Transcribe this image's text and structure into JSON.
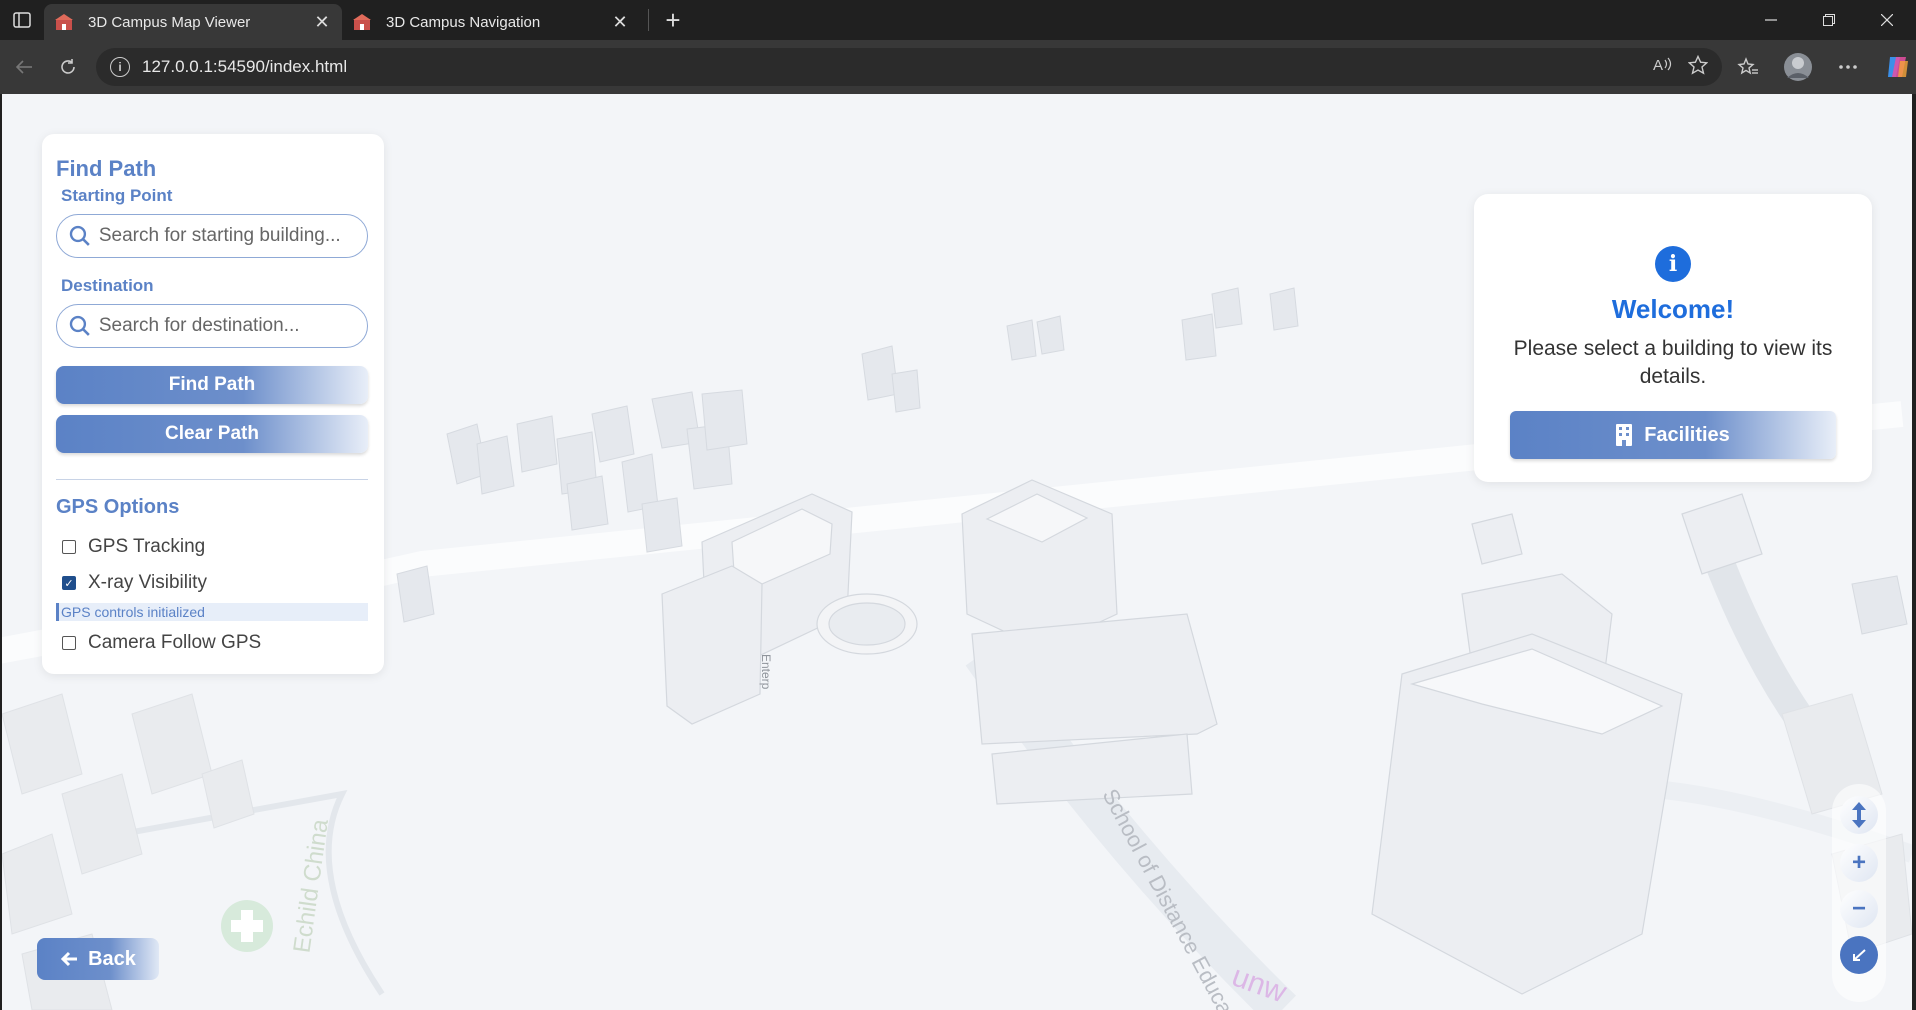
{
  "browser": {
    "tabs": [
      {
        "title": "3D Campus Map Viewer",
        "active": true
      },
      {
        "title": "3D Campus Navigation",
        "active": false
      }
    ],
    "url": "127.0.0.1:54590/index.html"
  },
  "find_path": {
    "title": "Find Path",
    "start_label": "Starting Point",
    "start_placeholder": "Search for starting building...",
    "dest_label": "Destination",
    "dest_placeholder": "Search for destination...",
    "find_button": "Find Path",
    "clear_button": "Clear Path"
  },
  "gps": {
    "title": "GPS Options",
    "tracking_label": "GPS Tracking",
    "tracking_checked": false,
    "xray_label": "X-ray Visibility",
    "xray_checked": true,
    "status": "GPS controls initialized",
    "follow_label": "Camera Follow GPS",
    "follow_checked": false
  },
  "welcome": {
    "title": "Welcome!",
    "message": "Please select a building to view its details.",
    "facilities_button": "Facilities"
  },
  "back_button": "Back",
  "map_labels": {
    "school": "School of Distance Education",
    "road": "Echild China",
    "label_vertical": "Enterp"
  },
  "colors": {
    "accent": "#5b82c6",
    "info_blue": "#1e6ddc"
  }
}
